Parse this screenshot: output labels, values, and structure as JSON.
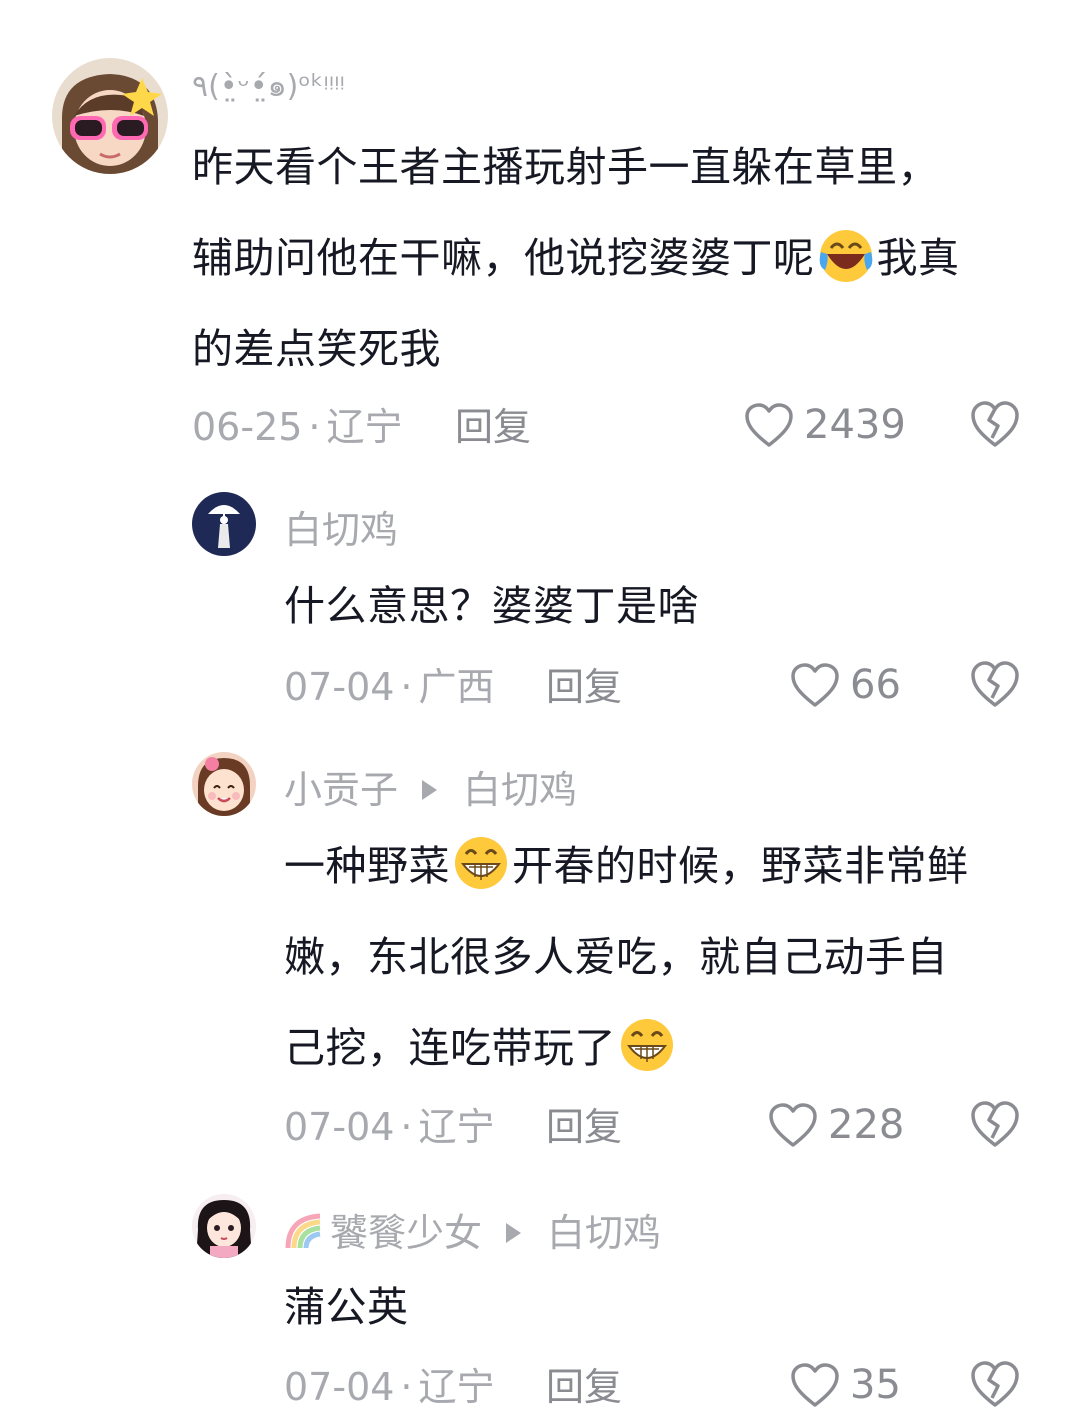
{
  "comments": [
    {
      "username": "٩(•̤̀ᵕ•̤́๑)ᵒᵏᵎᵎᵎᵎ",
      "line1": "昨天看个王者主播玩射手一直躲在草里，",
      "line2a": "辅助问他在干嘛，他说挖婆婆丁呢",
      "line2b": "我真",
      "line3": "的差点笑死我",
      "date": "06-25",
      "location": "辽宁",
      "reply_label": "回复",
      "likes": "2439",
      "emoji": "laugh-cry-emoji"
    },
    {
      "username": "白切鸡",
      "text": "什么意思？婆婆丁是啥",
      "date": "07-04",
      "location": "广西",
      "reply_label": "回复",
      "likes": "66"
    },
    {
      "username": "小贡子",
      "reply_to": "白切鸡",
      "line1a": "一种野菜",
      "line1b": "开春的时候，野菜非常鲜",
      "line2": "嫩，东北很多人爱吃，就自己动手自",
      "line3": "己挖，连吃带玩了",
      "date": "07-04",
      "location": "辽宁",
      "reply_label": "回复",
      "likes": "228",
      "emoji": "grin-emoji"
    },
    {
      "username": "饕餮少女",
      "reply_to": "白切鸡",
      "text": "蒲公英",
      "date": "07-04",
      "location": "辽宁",
      "reply_label": "回复",
      "likes": "35"
    }
  ],
  "colors": {
    "text": "#161823",
    "secondary": "#a7a9ae",
    "icon": "#8a8c92"
  }
}
